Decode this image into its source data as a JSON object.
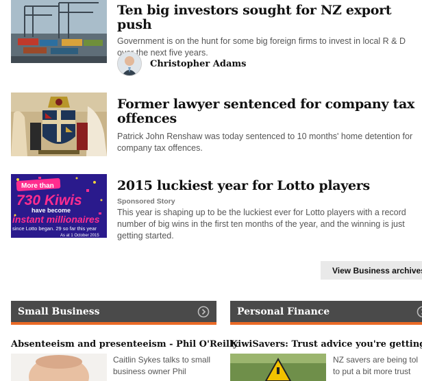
{
  "articles": [
    {
      "headline": "Ten big investors sought for NZ export push",
      "summary": "Government is on the hunt for some big foreign firms to invest in local R & D over the next five years.",
      "author": "Christopher Adams"
    },
    {
      "headline": "Former lawyer sentenced for company tax offences",
      "summary": "Patrick John Renshaw was today sentenced to 10 months' home detention for company tax offences."
    },
    {
      "headline": "2015 luckiest year for Lotto players",
      "sponsored": "Sponsored Story",
      "summary": "This year is shaping up to be the luckiest ever for Lotto players with a record number of big wins in the first ten months of the year, and the winning is just getting started.",
      "image_text": {
        "line1": "More than",
        "line2": "730 Kiwis",
        "line3": "have become",
        "line4": "instant millionaires",
        "line5": "since Lotto began. 29 so far this year",
        "line6": "As at 1 October 2015"
      }
    }
  ],
  "archive_button": "View Business archives",
  "sections": [
    {
      "title": "Small Business",
      "headline": "Absenteeism and presenteeism - Phil O'Reilly",
      "summary_line1": "Caitlin Sykes talks to small",
      "summary_line2": "business owner Phil"
    },
    {
      "title": "Personal Finance",
      "headline": "KiwiSavers: Trust advice you're getting",
      "summary_line1": "NZ savers are being tol",
      "summary_line2": "to put a bit more trust"
    }
  ],
  "colors": {
    "section_bar": "#4a4a4a",
    "section_accent": "#ea6a26",
    "button_bg": "#e9e9e9"
  },
  "icons": {
    "section_arrow": "chevron-right-circle-icon"
  }
}
